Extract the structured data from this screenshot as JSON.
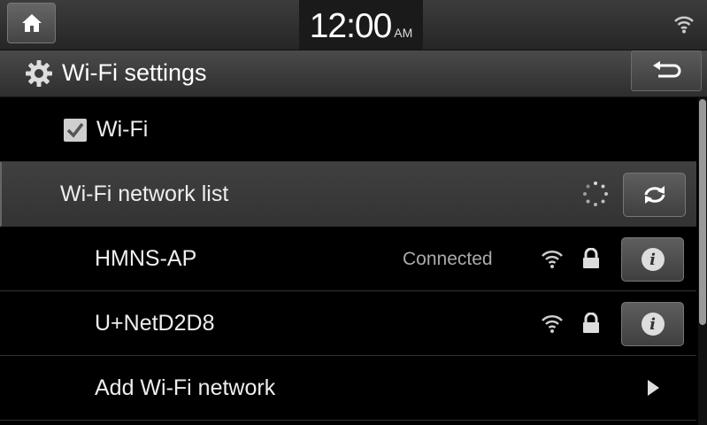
{
  "status_bar": {
    "time": "12:00",
    "ampm": "AM",
    "home_icon": "home-icon",
    "wifi_icon": "wifi-icon"
  },
  "header": {
    "title": "Wi-Fi settings",
    "gear_icon": "gear-icon",
    "back_icon": "back-arrow-icon"
  },
  "rows": {
    "wifi_toggle": {
      "label": "Wi-Fi",
      "checked": true
    },
    "network_list": {
      "label": "Wi-Fi network list"
    },
    "networks": [
      {
        "ssid": "HMNS-AP",
        "status": "Connected",
        "secured": true
      },
      {
        "ssid": "U+NetD2D8",
        "status": "",
        "secured": true
      }
    ],
    "add_network": {
      "label": "Add Wi-Fi network"
    }
  },
  "colors": {
    "background": "#000000",
    "highlight_row": "#3a3a3a",
    "text": "#eeeeee"
  }
}
